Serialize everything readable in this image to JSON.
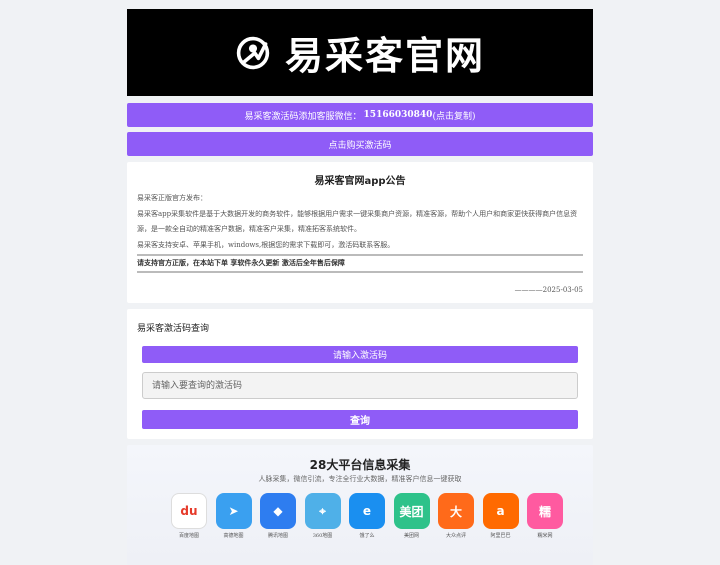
{
  "brand": {
    "name": "易采客官网"
  },
  "wechat": {
    "prefix": "易采客激活码添加客服微信：",
    "number": "15166030840",
    "suffix": " (点击复制)"
  },
  "buy": {
    "label": "点击购买激活码"
  },
  "notice": {
    "title": "易采客官网app公告",
    "lines": [
      "易采客正版官方发布：",
      "易采客app采集软件是基于大数据开发的商务软件，能够根据用户需求一键采集商户资源，精准客源，帮助个人用户和商家更快获得商户信息资",
      "源，是一款全自动的精准客户数据，精准客户采集，精准拓客系统软件。",
      "易采客支持安卓、苹果手机，windows,根据您的需求下载即可，激活码联系客服。"
    ],
    "highlight": "请支持官方正版，在本站下单 享软件永久更新 激活后全年售后保障",
    "date": "————2025-03-05"
  },
  "query": {
    "title": "易采客激活码查询",
    "input_label": "请输入激活码",
    "placeholder": "请输入要查询的激活码",
    "submit": "查询"
  },
  "promo": {
    "title": "28大平台信息采集",
    "subtitle": "人脉采集，微信引流，专注全行业大数据，精准客户信息一键获取",
    "apps": [
      {
        "name": "百度地图",
        "glyph": "du",
        "color": "#ffffff",
        "fg": "#e63a2a"
      },
      {
        "name": "高德地图",
        "glyph": "➤",
        "color": "#3aa0f0",
        "fg": "#ffffff"
      },
      {
        "name": "腾讯地图",
        "glyph": "◆",
        "color": "#2e7df0",
        "fg": "#ffffff"
      },
      {
        "name": "360地图",
        "glyph": "⌖",
        "color": "#4fb0e8",
        "fg": "#ffffff"
      },
      {
        "name": "饿了么",
        "glyph": "e",
        "color": "#1a8ff0",
        "fg": "#ffffff"
      },
      {
        "name": "美团网",
        "glyph": "美团",
        "color": "#2ec28a",
        "fg": "#ffffff"
      },
      {
        "name": "大众点评",
        "glyph": "大",
        "color": "#ff6a1a",
        "fg": "#ffffff"
      },
      {
        "name": "阿里巴巴",
        "glyph": "a",
        "color": "#ff6a00",
        "fg": "#ffffff"
      },
      {
        "name": "糯米网",
        "glyph": "糯",
        "color": "#ff5aa0",
        "fg": "#ffffff"
      }
    ]
  },
  "colors": {
    "accent": "#8f5cf7",
    "banner_bg": "#000000"
  }
}
